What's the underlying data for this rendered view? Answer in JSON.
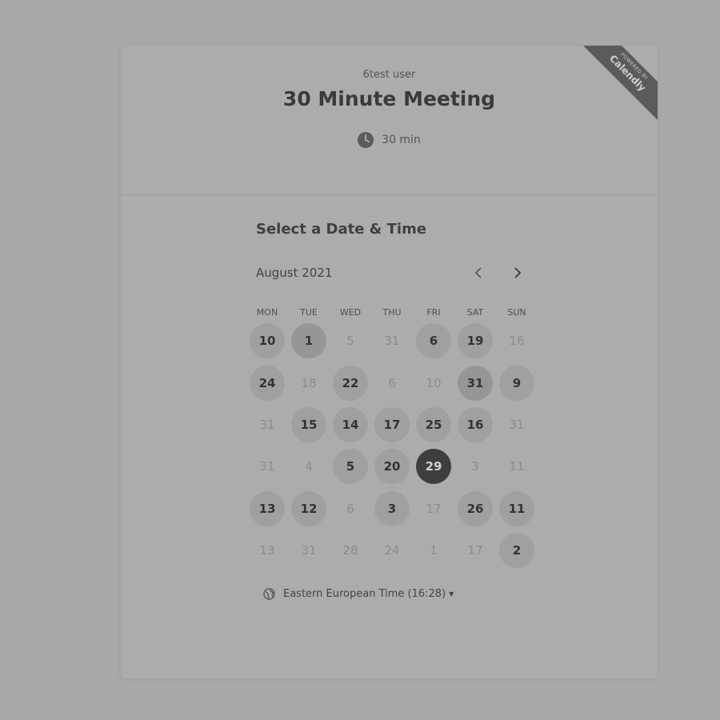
{
  "header": {
    "host": "6test user",
    "title": "30 Minute Meeting",
    "duration": "30 min",
    "ribbon_small": "POWERED BY",
    "ribbon_brand": "Calendly"
  },
  "scheduler": {
    "section_title": "Select a Date & Time",
    "month": "August 2021",
    "weekdays": [
      "MON",
      "TUE",
      "WED",
      "THU",
      "FRI",
      "SAT",
      "SUN"
    ],
    "weeks": [
      [
        {
          "label": "10",
          "available": true
        },
        {
          "label": "1",
          "available": true,
          "today": true
        },
        {
          "label": "5",
          "available": false
        },
        {
          "label": "31",
          "available": false
        },
        {
          "label": "6",
          "available": true
        },
        {
          "label": "19",
          "available": true
        },
        {
          "label": "16",
          "available": false
        }
      ],
      [
        {
          "label": "24",
          "available": true
        },
        {
          "label": "18",
          "available": false
        },
        {
          "label": "22",
          "available": true
        },
        {
          "label": "6",
          "available": false
        },
        {
          "label": "10",
          "available": false
        },
        {
          "label": "31",
          "available": true,
          "today": true
        },
        {
          "label": "9",
          "available": true
        }
      ],
      [
        {
          "label": "31",
          "available": false
        },
        {
          "label": "15",
          "available": true
        },
        {
          "label": "14",
          "available": true
        },
        {
          "label": "17",
          "available": true
        },
        {
          "label": "25",
          "available": true
        },
        {
          "label": "16",
          "available": true
        },
        {
          "label": "31",
          "available": false
        }
      ],
      [
        {
          "label": "31",
          "available": false
        },
        {
          "label": "4",
          "available": false
        },
        {
          "label": "5",
          "available": true
        },
        {
          "label": "20",
          "available": true
        },
        {
          "label": "29",
          "available": true,
          "selected": true
        },
        {
          "label": "3",
          "available": false
        },
        {
          "label": "11",
          "available": false
        }
      ],
      [
        {
          "label": "13",
          "available": true
        },
        {
          "label": "12",
          "available": true
        },
        {
          "label": "6",
          "available": false
        },
        {
          "label": "3",
          "available": true
        },
        {
          "label": "17",
          "available": false
        },
        {
          "label": "26",
          "available": true
        },
        {
          "label": "11",
          "available": true
        }
      ],
      [
        {
          "label": "13",
          "available": false
        },
        {
          "label": "31",
          "available": false
        },
        {
          "label": "28",
          "available": false
        },
        {
          "label": "24",
          "available": false
        },
        {
          "label": "1",
          "available": false
        },
        {
          "label": "17",
          "available": false
        },
        {
          "label": "2",
          "available": true
        }
      ]
    ],
    "timezone": "Eastern European Time (16:28)"
  },
  "icons": {
    "clock": "clock-icon",
    "prev": "chevron-left-icon",
    "next": "chevron-right-icon",
    "globe": "globe-icon",
    "caret": "caret-down-icon"
  }
}
